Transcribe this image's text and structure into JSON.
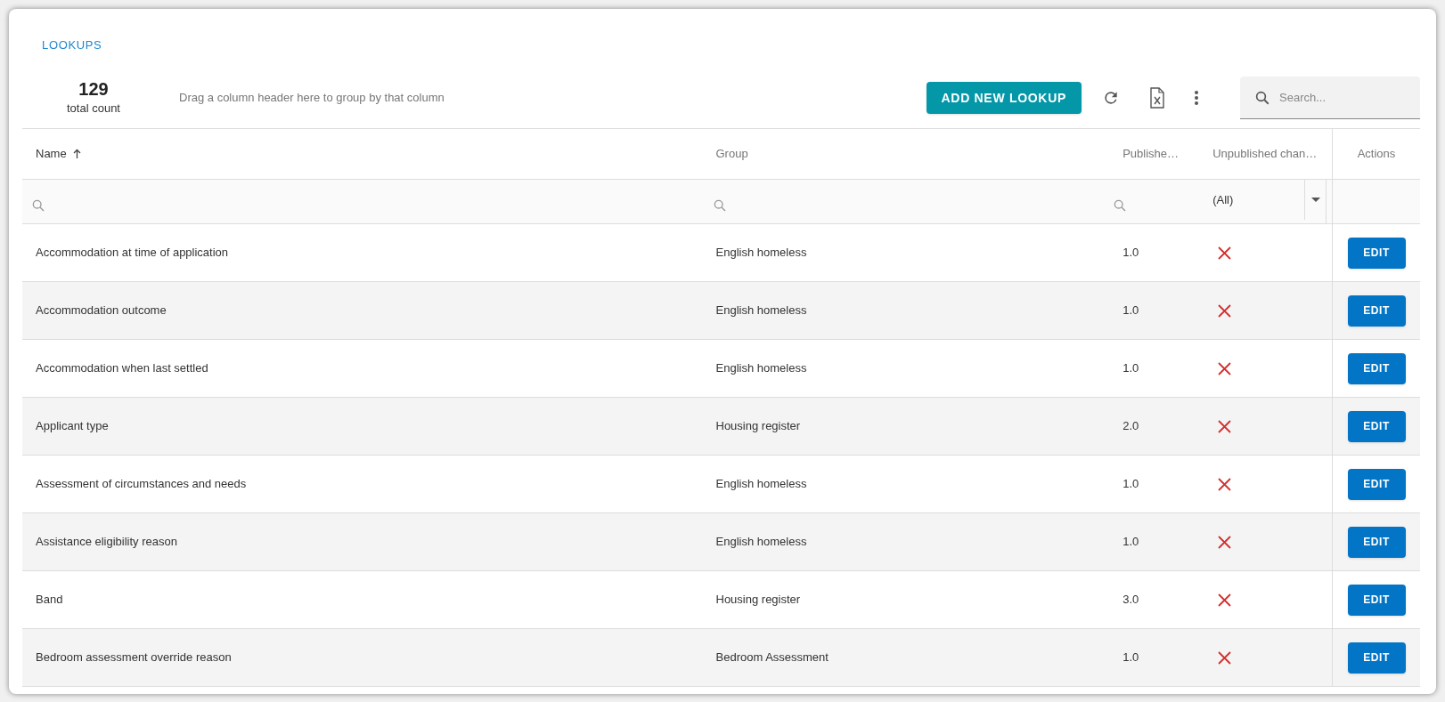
{
  "page_title": "LOOKUPS",
  "count": {
    "value": "129",
    "label": "total count"
  },
  "group_hint": "Drag a column header here to group by that column",
  "toolbar": {
    "add_button": "ADD NEW LOOKUP",
    "search": {
      "placeholder": "Search..."
    }
  },
  "table": {
    "columns": [
      {
        "label": "Name",
        "sorted": true
      },
      {
        "label": "Group",
        "sorted": false
      },
      {
        "label": "Publishe…",
        "sorted": false
      },
      {
        "label": "Unpublished chan…",
        "sorted": false
      },
      {
        "label": "Actions",
        "sorted": false
      }
    ],
    "filter": {
      "unpublished_value": "(All)"
    },
    "rows": [
      {
        "name": "Accommodation at time of application",
        "group": "English homeless",
        "published": "1.0",
        "unpublished_changes": false,
        "action": "EDIT"
      },
      {
        "name": "Accommodation outcome",
        "group": "English homeless",
        "published": "1.0",
        "unpublished_changes": false,
        "action": "EDIT"
      },
      {
        "name": "Accommodation when last settled",
        "group": "English homeless",
        "published": "1.0",
        "unpublished_changes": false,
        "action": "EDIT"
      },
      {
        "name": "Applicant type",
        "group": "Housing register",
        "published": "2.0",
        "unpublished_changes": false,
        "action": "EDIT"
      },
      {
        "name": "Assessment of circumstances and needs",
        "group": "English homeless",
        "published": "1.0",
        "unpublished_changes": false,
        "action": "EDIT"
      },
      {
        "name": "Assistance eligibility reason",
        "group": "English homeless",
        "published": "1.0",
        "unpublished_changes": false,
        "action": "EDIT"
      },
      {
        "name": "Band",
        "group": "Housing register",
        "published": "3.0",
        "unpublished_changes": false,
        "action": "EDIT"
      },
      {
        "name": "Bedroom assessment override reason",
        "group": "Bedroom Assessment",
        "published": "1.0",
        "unpublished_changes": false,
        "action": "EDIT"
      }
    ]
  }
}
